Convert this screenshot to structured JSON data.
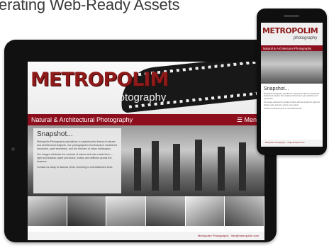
{
  "heading": "nerating Web-Ready Assets",
  "site": {
    "logo_main": "METROPOLIM",
    "logo_sub": "photography",
    "nav_title": "Natural & Architectural Photography",
    "nav_menu": "☰ Menu",
    "section_title": "Snapshot...",
    "paragraphs": [
      "Metropolim Photography specializes in capturing the drama of natural and architectural subjects. Our photographers find beauty in weathered structures, quiet shorelines, and the textures of urban landscapes.",
      "Our images celebrate the contrast of nature and man-made form — light and shadow, water and stone, motion and stillness across the seasons.",
      "Contact us today to discuss prints, licensing or commissioned work."
    ],
    "footer_text": "Metropolim Photography · info@metropolim.com",
    "colors": {
      "brand": "#8d0e1c",
      "logo": "#8e1a1a"
    }
  },
  "phone": {
    "logo_main": "METROPOLIM",
    "logo_sub": "photography",
    "nav_title": "Natural & Architectural Photography",
    "section_title": "Snapshot...",
    "paragraphs": [
      "Metropolim Photography specializes in capturing the drama of natural and architectural subjects, from weathered structures to quiet shorelines and city textures.",
      "Our images celebrate the contrast of nature and man-made form, light and shadow, water and stone across every season.",
      "Contact us to discuss prints or commissioned work."
    ],
    "footer_text": "Metropolim Photography · info@metropolim.com"
  }
}
